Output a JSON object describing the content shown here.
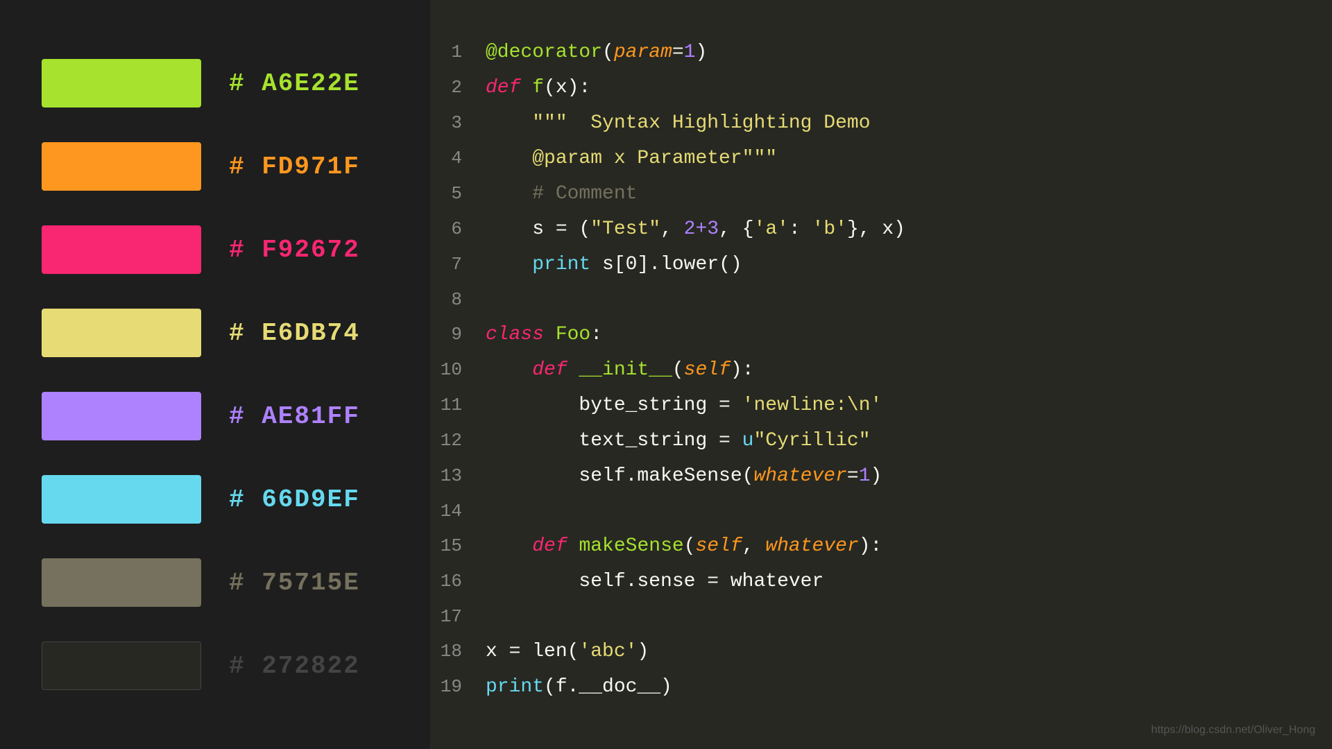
{
  "left": {
    "colors": [
      {
        "swatch": "#a6e22e",
        "label": "# A6E22E",
        "label_color": "#a6e22e"
      },
      {
        "swatch": "#fd971f",
        "label": "# FD971F",
        "label_color": "#fd971f"
      },
      {
        "swatch": "#f92672",
        "label": "# F92672",
        "label_color": "#f92672"
      },
      {
        "swatch": "#e6db74",
        "label": "# E6DB74",
        "label_color": "#e6db74"
      },
      {
        "swatch": "#ae81ff",
        "label": "# AE81FF",
        "label_color": "#ae81ff"
      },
      {
        "swatch": "#66d9ef",
        "label": "# 66D9EF",
        "label_color": "#66d9ef"
      },
      {
        "swatch": "#75715e",
        "label": "# 75715E",
        "label_color": "#75715e"
      },
      {
        "swatch": "#272822",
        "label": "# 272822",
        "label_color": "#444"
      }
    ]
  },
  "watermark": "https://blog.csdn.net/Oliver_Hong"
}
